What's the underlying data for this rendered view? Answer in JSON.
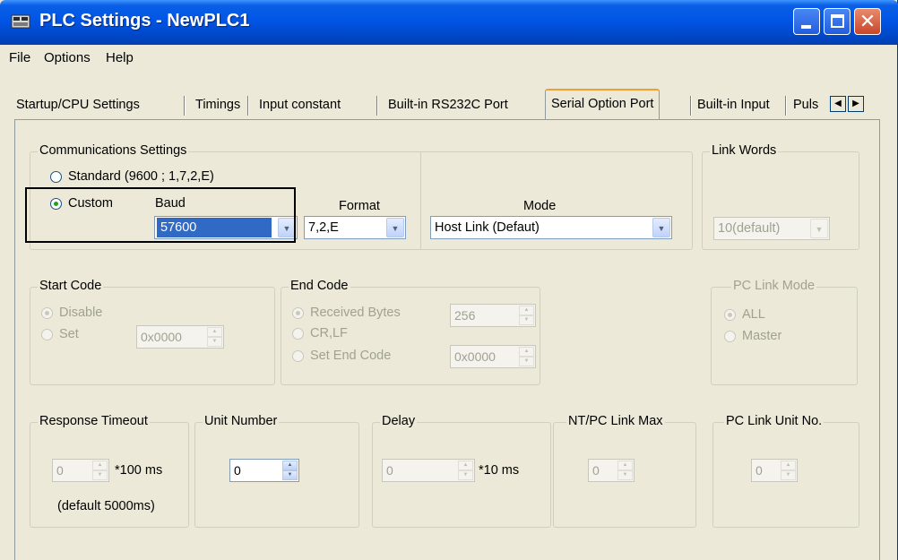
{
  "window": {
    "title": "PLC Settings - NewPLC1"
  },
  "menu": [
    "File",
    "Options",
    "Help"
  ],
  "tabs": [
    "Startup/CPU Settings",
    "Timings",
    "Input constant",
    "Built-in RS232C Port",
    "Serial Option Port",
    "Built-in Input",
    "Puls"
  ],
  "active_tab": "Serial Option Port",
  "comm": {
    "label": "Communications Settings",
    "standard": "Standard (9600 ; 1,7,2,E)",
    "custom": "Custom",
    "baud_label": "Baud",
    "baud_value": "57600",
    "format_label": "Format",
    "format_value": "7,2,E",
    "mode_label": "Mode",
    "mode_value": "Host Link (Defaut)"
  },
  "link_words": {
    "label": "Link Words",
    "value": "10(default)"
  },
  "start_code": {
    "label": "Start Code",
    "disable": "Disable",
    "set": "Set",
    "value": "0x0000"
  },
  "end_code": {
    "label": "End Code",
    "received": "Received Bytes",
    "received_value": "256",
    "crlf": "CR,LF",
    "set_end": "Set End Code",
    "set_end_value": "0x0000"
  },
  "pc_link_mode": {
    "label": "PC Link Mode",
    "all": "ALL",
    "master": "Master"
  },
  "response_timeout": {
    "label": "Response Timeout",
    "value": "0",
    "unit": "*100 ms",
    "note": "(default 5000ms)"
  },
  "unit_number": {
    "label": "Unit Number",
    "value": "0"
  },
  "delay": {
    "label": "Delay",
    "value": "0",
    "unit": "*10 ms"
  },
  "nt_pc_link_max": {
    "label": "NT/PC Link Max",
    "value": "0"
  },
  "pc_link_unit_no": {
    "label": "PC Link Unit No.",
    "value": "0"
  }
}
